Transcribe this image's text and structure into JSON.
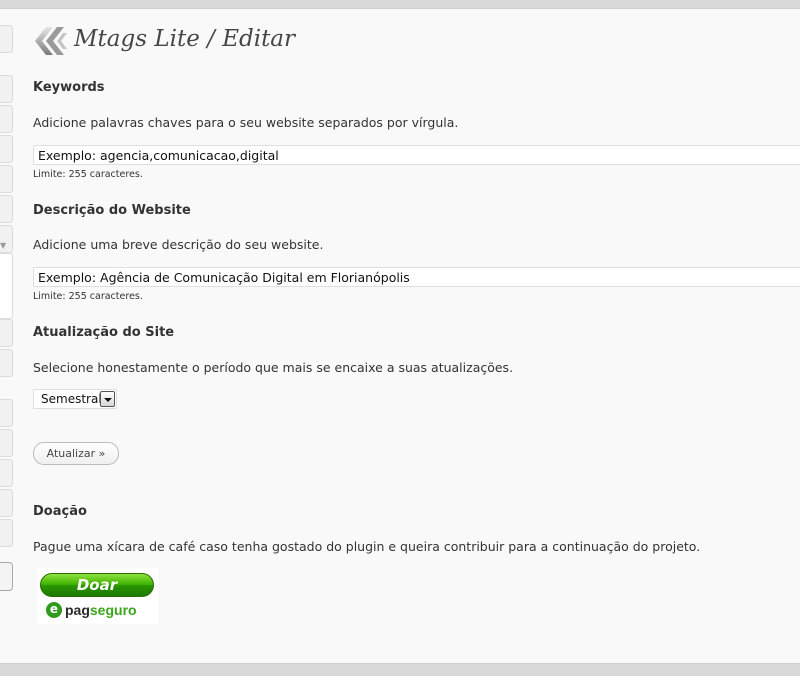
{
  "page": {
    "title": "Mtags Lite / Editar"
  },
  "keywords": {
    "heading": "Keywords",
    "description": "Adicione palavras chaves para o seu website separados por vírgula.",
    "value": "Exemplo: agencia,comunicacao,digital",
    "limit": "Limite: 255 caracteres."
  },
  "site_description": {
    "heading": "Descrição do Website",
    "description": "Adicione uma breve descrição do seu website.",
    "value": "Exemplo: Agência de Comunicação Digital em Florianópolis",
    "limit": "Limite: 255 caracteres."
  },
  "site_update": {
    "heading": "Atualização do Site",
    "description": "Selecione honestamente o período que mais se encaixe a suas atualizações.",
    "selected": "Semestral"
  },
  "form": {
    "submit_label": "Atualizar »"
  },
  "donation": {
    "heading": "Doação",
    "description": "Pague uma xícara de café caso tenha gostado do plugin e queira contribuir para a continuação do projeto.",
    "button_label": "Doar",
    "logo_prefix": "pag",
    "logo_suffix": "seguro",
    "logo_mark": "e"
  },
  "icons": {
    "logo": "mtags-logo-icon",
    "select_arrow": "chevron-down-icon"
  },
  "colors": {
    "donate_green": "#3fb200",
    "pagseguro_green": "#3aa61c",
    "background": "#f9f9f9"
  }
}
